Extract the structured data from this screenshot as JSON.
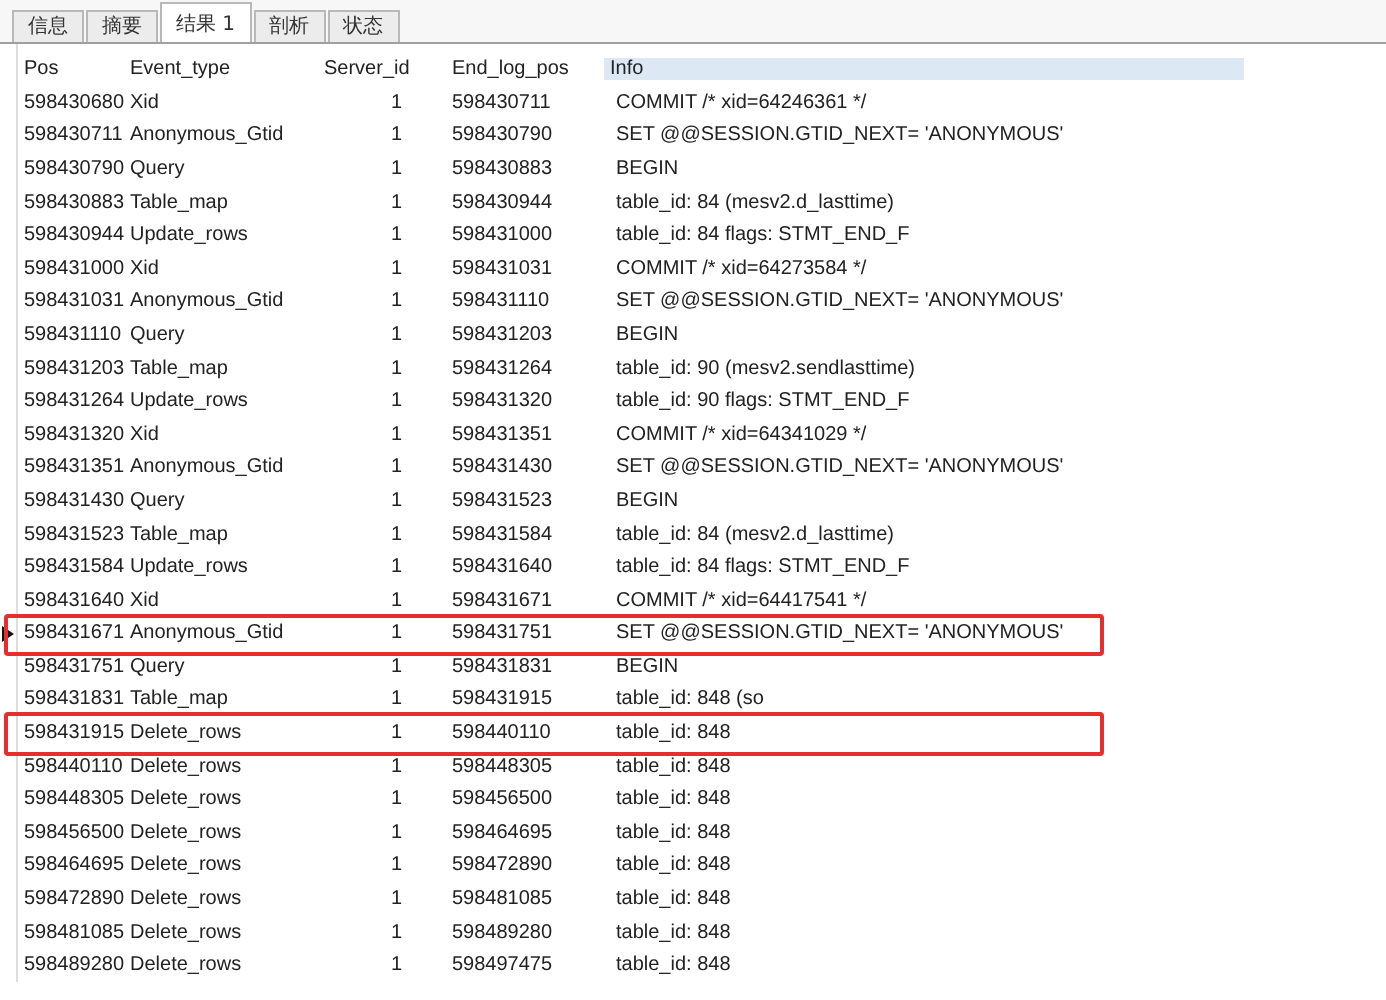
{
  "tabs": [
    {
      "label": "信息",
      "selected": false
    },
    {
      "label": "摘要",
      "selected": false
    },
    {
      "label": "结果 1",
      "selected": true
    },
    {
      "label": "剖析",
      "selected": false
    },
    {
      "label": "状态",
      "selected": false
    }
  ],
  "table": {
    "columns": [
      "Pos",
      "Event_type",
      "Server_id",
      "End_log_pos",
      "Info"
    ],
    "rows": [
      {
        "cells": [
          "598430680",
          "Xid",
          "1",
          "598430711",
          "COMMIT /* xid=64246361 */"
        ],
        "current": false,
        "highlighted": false
      },
      {
        "cells": [
          "598430711",
          "Anonymous_Gtid",
          "1",
          "598430790",
          "SET @@SESSION.GTID_NEXT= 'ANONYMOUS'"
        ],
        "current": false,
        "highlighted": false
      },
      {
        "cells": [
          "598430790",
          "Query",
          "1",
          "598430883",
          "BEGIN"
        ],
        "current": false,
        "highlighted": false
      },
      {
        "cells": [
          "598430883",
          "Table_map",
          "1",
          "598430944",
          "table_id: 84 (mesv2.d_lasttime)"
        ],
        "current": false,
        "highlighted": false
      },
      {
        "cells": [
          "598430944",
          "Update_rows",
          "1",
          "598431000",
          "table_id: 84 flags: STMT_END_F"
        ],
        "current": false,
        "highlighted": false
      },
      {
        "cells": [
          "598431000",
          "Xid",
          "1",
          "598431031",
          "COMMIT /* xid=64273584 */"
        ],
        "current": false,
        "highlighted": false
      },
      {
        "cells": [
          "598431031",
          "Anonymous_Gtid",
          "1",
          "598431110",
          "SET @@SESSION.GTID_NEXT= 'ANONYMOUS'"
        ],
        "current": false,
        "highlighted": false
      },
      {
        "cells": [
          "598431110",
          "Query",
          "1",
          "598431203",
          "BEGIN"
        ],
        "current": false,
        "highlighted": false
      },
      {
        "cells": [
          "598431203",
          "Table_map",
          "1",
          "598431264",
          "table_id: 90 (mesv2.sendlasttime)"
        ],
        "current": false,
        "highlighted": false
      },
      {
        "cells": [
          "598431264",
          "Update_rows",
          "1",
          "598431320",
          "table_id: 90 flags: STMT_END_F"
        ],
        "current": false,
        "highlighted": false
      },
      {
        "cells": [
          "598431320",
          "Xid",
          "1",
          "598431351",
          "COMMIT /* xid=64341029 */"
        ],
        "current": false,
        "highlighted": false
      },
      {
        "cells": [
          "598431351",
          "Anonymous_Gtid",
          "1",
          "598431430",
          "SET @@SESSION.GTID_NEXT= 'ANONYMOUS'"
        ],
        "current": false,
        "highlighted": false
      },
      {
        "cells": [
          "598431430",
          "Query",
          "1",
          "598431523",
          "BEGIN"
        ],
        "current": false,
        "highlighted": false
      },
      {
        "cells": [
          "598431523",
          "Table_map",
          "1",
          "598431584",
          "table_id: 84 (mesv2.d_lasttime)"
        ],
        "current": false,
        "highlighted": false
      },
      {
        "cells": [
          "598431584",
          "Update_rows",
          "1",
          "598431640",
          "table_id: 84 flags: STMT_END_F"
        ],
        "current": false,
        "highlighted": false
      },
      {
        "cells": [
          "598431640",
          "Xid",
          "1",
          "598431671",
          "COMMIT /* xid=64417541 */"
        ],
        "current": false,
        "highlighted": false
      },
      {
        "cells": [
          "598431671",
          "Anonymous_Gtid",
          "1",
          "598431751",
          "SET @@SESSION.GTID_NEXT= 'ANONYMOUS'"
        ],
        "current": true,
        "highlighted": true
      },
      {
        "cells": [
          "598431751",
          "Query",
          "1",
          "598431831",
          "BEGIN"
        ],
        "current": false,
        "highlighted": false
      },
      {
        "cells": [
          "598431831",
          "Table_map",
          "1",
          "598431915",
          "table_id: 848 (so"
        ],
        "current": false,
        "highlighted": false
      },
      {
        "cells": [
          "598431915",
          "Delete_rows",
          "1",
          "598440110",
          "table_id: 848"
        ],
        "current": false,
        "highlighted": true
      },
      {
        "cells": [
          "598440110",
          "Delete_rows",
          "1",
          "598448305",
          "table_id: 848"
        ],
        "current": false,
        "highlighted": false
      },
      {
        "cells": [
          "598448305",
          "Delete_rows",
          "1",
          "598456500",
          "table_id: 848"
        ],
        "current": false,
        "highlighted": false
      },
      {
        "cells": [
          "598456500",
          "Delete_rows",
          "1",
          "598464695",
          "table_id: 848"
        ],
        "current": false,
        "highlighted": false
      },
      {
        "cells": [
          "598464695",
          "Delete_rows",
          "1",
          "598472890",
          "table_id: 848"
        ],
        "current": false,
        "highlighted": false
      },
      {
        "cells": [
          "598472890",
          "Delete_rows",
          "1",
          "598481085",
          "table_id: 848"
        ],
        "current": false,
        "highlighted": false
      },
      {
        "cells": [
          "598481085",
          "Delete_rows",
          "1",
          "598489280",
          "table_id: 848"
        ],
        "current": false,
        "highlighted": false
      },
      {
        "cells": [
          "598489280",
          "Delete_rows",
          "1",
          "598497475",
          "table_id: 848"
        ],
        "current": false,
        "highlighted": false
      }
    ]
  }
}
